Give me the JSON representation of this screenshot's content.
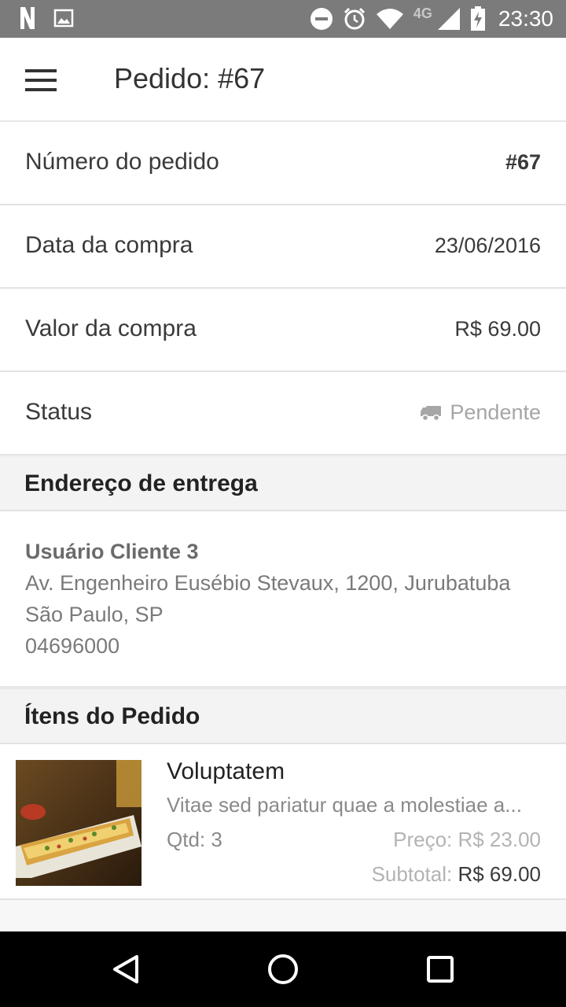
{
  "status_bar": {
    "time": "23:30",
    "network": "4G",
    "icons": [
      "n-icon",
      "image-icon",
      "dnd-icon",
      "alarm-icon",
      "wifi-icon",
      "signal-icon",
      "battery-icon"
    ]
  },
  "app_bar": {
    "title": "Pedido: #67",
    "menu_icon": "hamburger-menu-icon"
  },
  "order": {
    "number_label": "Número do pedido",
    "number_value": "#67",
    "date_label": "Data da compra",
    "date_value": "23/06/2016",
    "amount_label": "Valor da compra",
    "amount_value": "R$ 69.00",
    "status_label": "Status",
    "status_value": "Pendente",
    "status_icon": "truck-icon"
  },
  "address_section": {
    "title": "Endereço de entrega",
    "name": "Usuário Cliente 3",
    "street": "Av. Engenheiro Eusébio Stevaux, 1200, Jurubatuba",
    "city": "São Paulo, SP",
    "zip": "04696000"
  },
  "items_section": {
    "title": "Ítens do Pedido",
    "items": [
      {
        "name": "Voluptatem",
        "description": "Vitae sed pariatur quae a molestiae a...",
        "qty_text": "Qtd: 3",
        "price_text": "Preço: R$ 23.00",
        "subtotal_label": "Subtotal:",
        "subtotal_value": "R$ 69.00"
      }
    ]
  },
  "nav_bar": {
    "icons": [
      "back-icon",
      "home-icon",
      "recents-icon"
    ]
  },
  "colors": {
    "status_bar": "#7b7b7b",
    "section_header": "#f3f3f3",
    "muted_text": "#a6a6a6"
  }
}
